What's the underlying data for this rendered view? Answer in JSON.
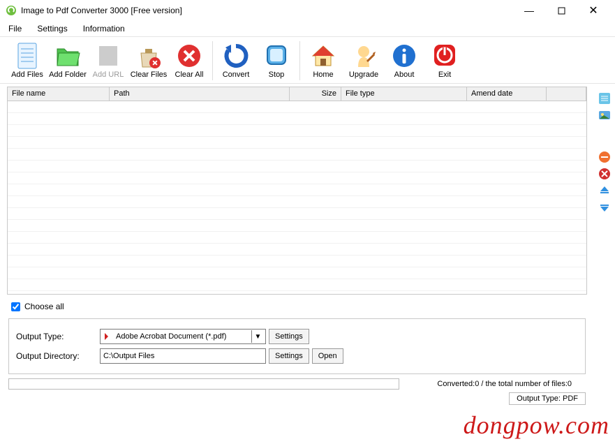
{
  "title": "Image to Pdf Converter 3000 [Free version]",
  "menu": {
    "file": "File",
    "settings": "Settings",
    "info": "Information"
  },
  "toolbar": {
    "addFiles": "Add Files",
    "addFolder": "Add Folder",
    "addUrl": "Add URL",
    "clearFiles": "Clear Files",
    "clearAll": "Clear All",
    "convert": "Convert",
    "stop": "Stop",
    "home": "Home",
    "upgrade": "Upgrade",
    "about": "About",
    "exit": "Exit"
  },
  "columns": {
    "name": "File name",
    "path": "Path",
    "size": "Size",
    "type": "File type",
    "date": "Amend date"
  },
  "chooseAll": "Choose all",
  "output": {
    "typeLabel": "Output Type:",
    "typeValue": "Adobe Acrobat Document (*.pdf)",
    "dirLabel": "Output Directory:",
    "dirValue": "C:\\Output Files",
    "settings": "Settings",
    "open": "Open"
  },
  "status": {
    "text": "Converted:0  /  the total number of files:0",
    "outputType": "Output Type: PDF"
  },
  "watermark": "dongpow.com"
}
